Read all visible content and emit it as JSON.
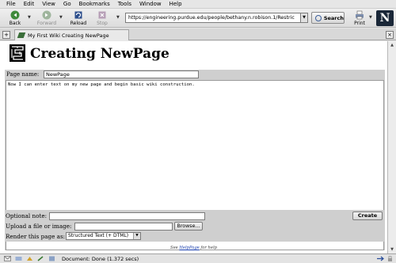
{
  "menu": [
    "File",
    "Edit",
    "View",
    "Go",
    "Bookmarks",
    "Tools",
    "Window",
    "Help"
  ],
  "toolbar": {
    "back": "Back",
    "forward": "Forward",
    "reload": "Reload",
    "stop": "Stop",
    "print": "Print",
    "search": "Search",
    "url": "https://engineering.purdue.edu/people/bethany.n.robison.1/Restric"
  },
  "tab": {
    "title": "My First Wiki Creating NewPage"
  },
  "page": {
    "title": "Creating NewPage",
    "page_name_label": "Page name:",
    "page_name_value": "NewPage",
    "body_text": "Now I can enter text on my new page and begin basic wiki construction.",
    "optional_note_label": "Optional note:",
    "create_label": "Create",
    "upload_label": "Upload a file or image:",
    "browse_label": "Browse...",
    "render_label": "Render this page as:",
    "render_value": "Structured Text (+ DTML)",
    "help_prefix": "See",
    "help_link": "HelpPage",
    "help_suffix": "for help"
  },
  "status": {
    "text": "Document: Done (1.372 secs)"
  },
  "colors": {
    "brand_bg": "#1a2738",
    "link": "#1a3fae",
    "form_panel": "#cfcfcf"
  }
}
